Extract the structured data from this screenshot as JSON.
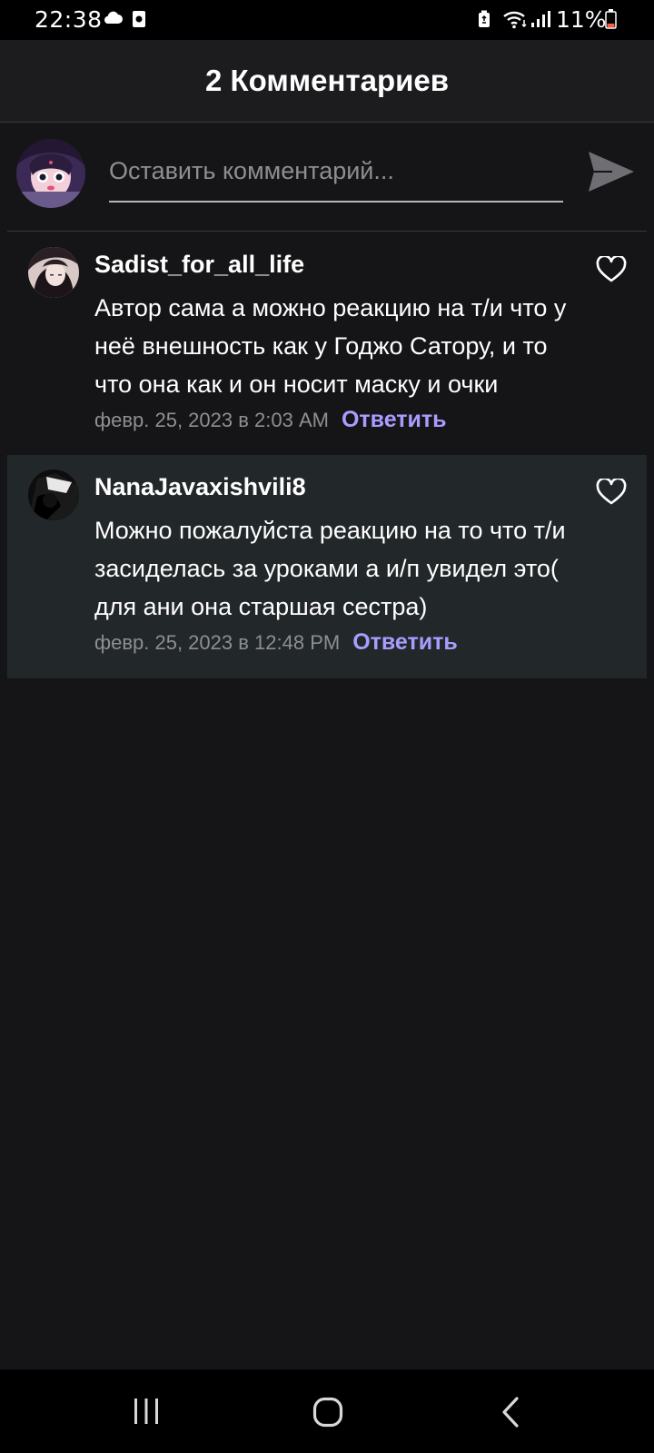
{
  "status_bar": {
    "time": "22:38",
    "battery_percent": "11%",
    "icons": [
      "cloud-icon",
      "media-icon",
      "battery-saver-icon",
      "wifi-icon",
      "signal-icon",
      "battery-icon"
    ]
  },
  "header": {
    "title": "2 Комментариев"
  },
  "compose": {
    "placeholder": "Оставить комментарий...",
    "value": "",
    "send_icon": "send-icon"
  },
  "comments": [
    {
      "author": "Sadist_for_all_life",
      "text": "Автор сама а можно реакцию на т/и что у неё внешность как у Годжо Сатору, и то что она как и он носит маску и очки",
      "timestamp": "февр. 25, 2023 в 2:03 AM",
      "reply_label": "Ответить",
      "like_icon": "heart-outline-icon",
      "highlighted": false
    },
    {
      "author": "NanaJavaxishvili8",
      "text": "Можно пожалуйста реакцию на то что т/и засиделась за уроками а и/п увидел это( для ани она старшая сестра)",
      "timestamp": "февр. 25, 2023 в 12:48 PM",
      "reply_label": "Ответить",
      "like_icon": "heart-outline-icon",
      "highlighted": true
    }
  ],
  "nav_bar": {
    "icons": [
      "recents-icon",
      "home-icon",
      "back-icon"
    ]
  },
  "colors": {
    "background": "#151517",
    "header": "#1c1c1e",
    "highlight_row": "#222729",
    "accent": "#a99cff",
    "meta_text": "#8e8e93"
  }
}
